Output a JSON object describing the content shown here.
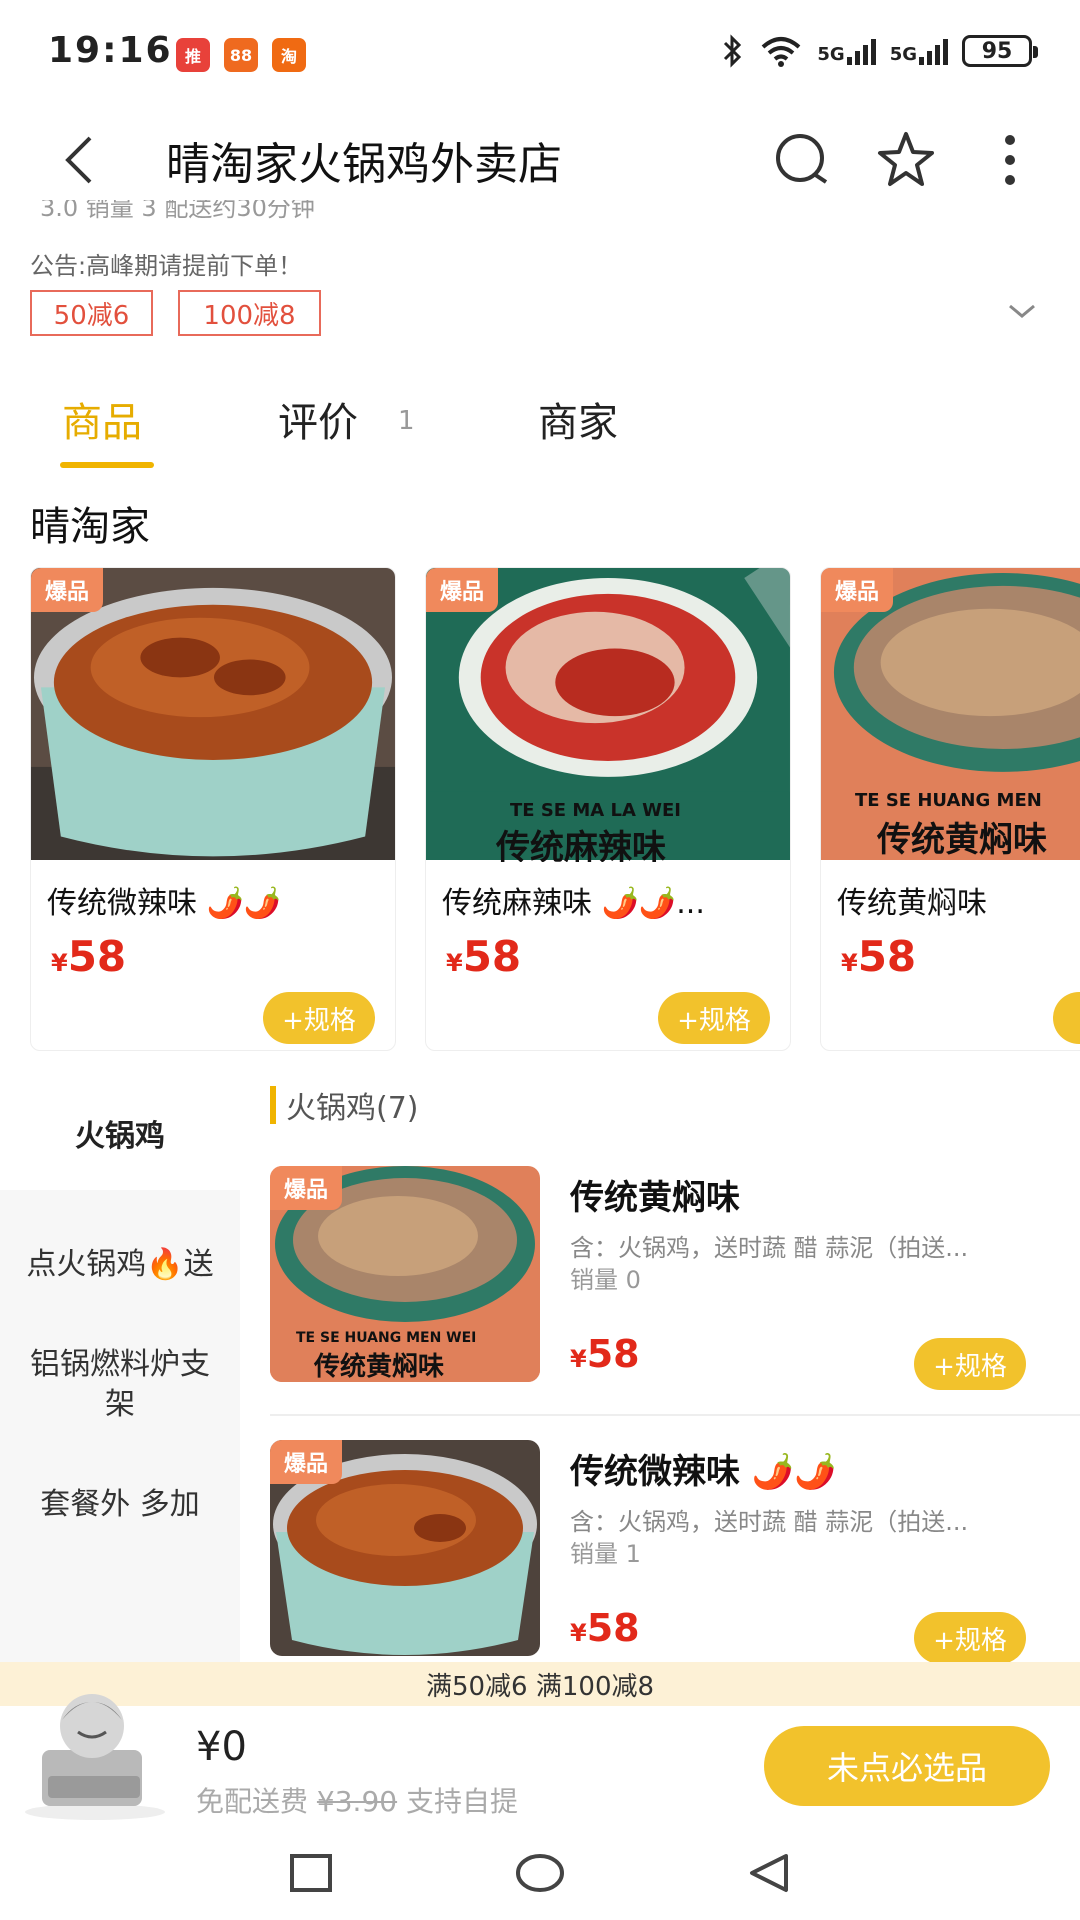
{
  "status": {
    "time": "19:16",
    "apps": [
      "推",
      "88",
      "淘"
    ],
    "network": [
      "5G",
      "5G"
    ],
    "battery": "95"
  },
  "header": {
    "title": "晴淘家火锅鸡外卖店"
  },
  "shop": {
    "rating_line": "3.0  销量 3  配送约30分钟",
    "notice": "公告:高峰期请提前下单！",
    "coupons": [
      "50减6",
      "100减8"
    ]
  },
  "tabs": {
    "goods": "商品",
    "reviews": "评价",
    "reviews_count": "1",
    "merchant": "商家"
  },
  "section_title": "晴淘家",
  "carousel": [
    {
      "badge": "爆品",
      "name": "传统微辣味 🌶️🌶️",
      "yen": "¥",
      "price": "58",
      "button": "+规格"
    },
    {
      "badge": "爆品",
      "name": "传统麻辣味 🌶️🌶️...",
      "img_caption_en": "TE SE MA LA WEI",
      "img_caption": "传统麻辣味",
      "yen": "¥",
      "price": "58",
      "button": "+规格"
    },
    {
      "badge": "爆品",
      "name": "传统黄焖味",
      "img_caption_en": "TE SE HUANG MEN",
      "img_caption": "传统黄焖味",
      "yen": "¥",
      "price": "58",
      "button": "+"
    }
  ],
  "categories": [
    {
      "label": "火锅鸡"
    },
    {
      "label": "点火锅鸡🔥送"
    },
    {
      "label": "铝锅燃料炉支架"
    },
    {
      "label": "套餐外  多加"
    }
  ],
  "list": {
    "heading": "火锅鸡(7)",
    "items": [
      {
        "badge": "爆品",
        "name": "传统黄焖味",
        "desc": "含：火锅鸡，送时蔬 醋 蒜泥（拍送...",
        "sales": "销量 0",
        "img_caption_en": "TE SE HUANG MEN WEI",
        "img_caption": "传统黄焖味",
        "yen": "¥",
        "price": "58",
        "button": "+规格"
      },
      {
        "badge": "爆品",
        "name": "传统微辣味 🌶️🌶️",
        "desc": "含：火锅鸡，送时蔬 醋 蒜泥（拍送...",
        "sales": "销量 1",
        "yen": "¥",
        "price": "58",
        "button": "+规格"
      }
    ]
  },
  "promo": "满50减6  满100减8",
  "cart": {
    "total": "¥0",
    "delivery": "免配送费",
    "old_fee": "¥3.90",
    "pickup": "支持自提",
    "checkout": "未点必选品"
  },
  "colors": {
    "accent": "#f2c22c",
    "price": "#e2291a",
    "coupon": "#e2503d",
    "badge": "#f0895c"
  }
}
